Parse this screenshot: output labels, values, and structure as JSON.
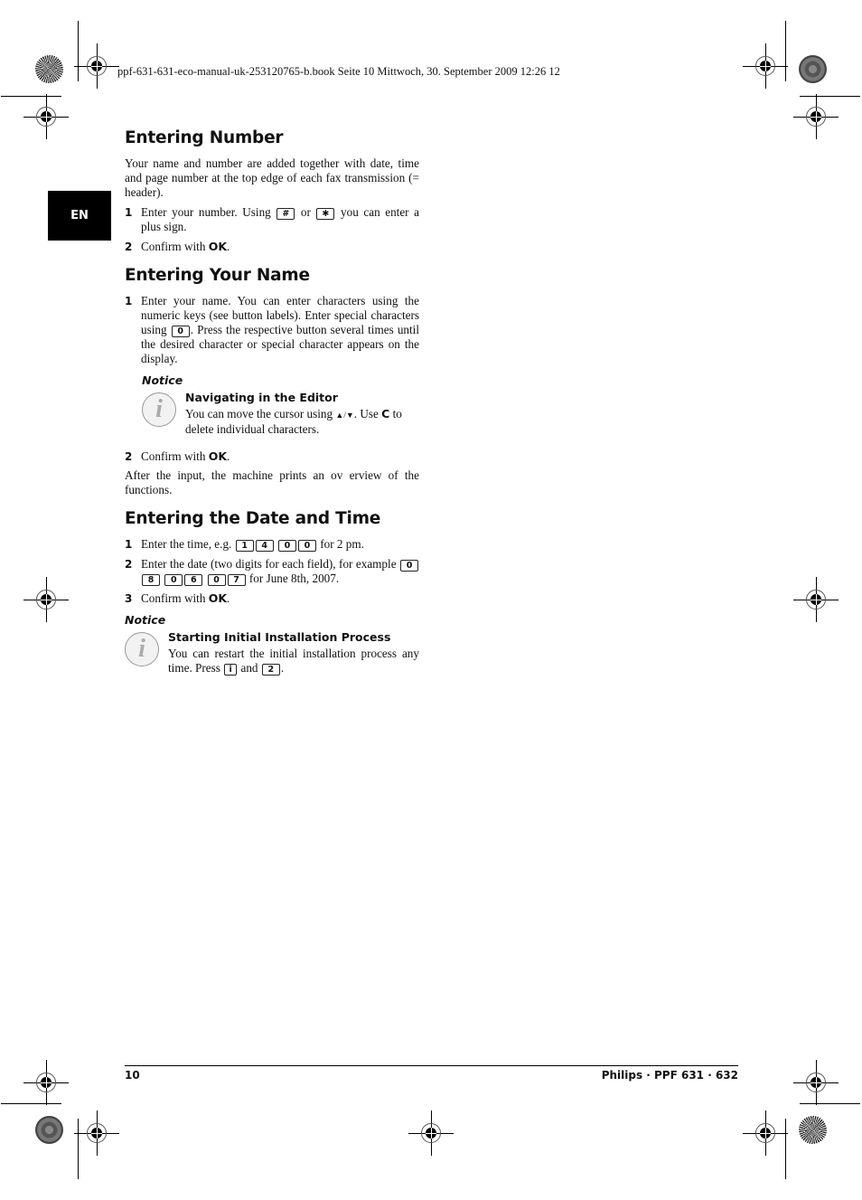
{
  "slug_line": "ppf-631-631-eco-manual-uk-253120765-b.book  Seite 10  Mittwoch, 30. September 2009  12:26 12",
  "language_tab": "EN",
  "sections": {
    "entering_number": {
      "heading": "Entering Number",
      "intro": "Your name and number are added together with date, time and page number at the top edge of each fax transmission (= header).",
      "step1_num": "1",
      "step1_a": "Enter your number. Using ",
      "key_hash": "#",
      "step1_or": " or ",
      "key_star": "✱",
      "step1_b": " you can enter a plus sign.",
      "step2_num": "2",
      "step2_text": "Confirm with ",
      "step2_ok": "OK",
      "step2_end": "."
    },
    "entering_name": {
      "heading": "Entering Your Name",
      "step1_num": "1",
      "step1_a": "Enter your name. You can enter characters using the numeric keys (see button labels).  Enter special characters using ",
      "key_0": "0",
      "step1_b": ". Press the respective button several times until the desired character or special character appears on the display.",
      "notice_label": "Notice",
      "notice_title": "Navigating in the Editor",
      "notice_text_a": "You can move the cursor using ",
      "notice_arrows": "▲/▼",
      "notice_text_b": ". Use ",
      "notice_c": "C",
      "notice_text_c": " to delete individual characters.",
      "step2_num": "2",
      "step2_text": "Confirm with ",
      "step2_ok": "OK",
      "step2_end": ".",
      "after": "After the input, the machine prints an ov   erview of the functions."
    },
    "entering_date_time": {
      "heading": "Entering the Date and Time",
      "step1_num": "1",
      "step1_a": "Enter the time, e.g. ",
      "time_keys": [
        "1",
        "4",
        "0",
        "0"
      ],
      "step1_b": " for 2 pm.",
      "step2_num": "2",
      "step2_a": "Enter the date (two digits for each field), for example ",
      "date_keys": [
        "0",
        "8",
        "0",
        "6",
        "0",
        "7"
      ],
      "step2_b": " for June 8th, 2007.",
      "step3_num": "3",
      "step3_text": "Confirm with ",
      "step3_ok": "OK",
      "step3_end": ".",
      "notice_label": "Notice",
      "notice_title": "Starting Initial Installation Process",
      "notice_text_a": "You can restart  the initial installation process any time. Press ",
      "key_i": "i",
      "notice_and": " and ",
      "key_2": "2",
      "notice_end": "."
    }
  },
  "footer": {
    "page_number": "10",
    "product": "Philips · PPF 631 · 632"
  },
  "icons": {
    "notice": "info-icon",
    "registration": "registration-mark-icon",
    "color_target": "color-target-icon"
  }
}
